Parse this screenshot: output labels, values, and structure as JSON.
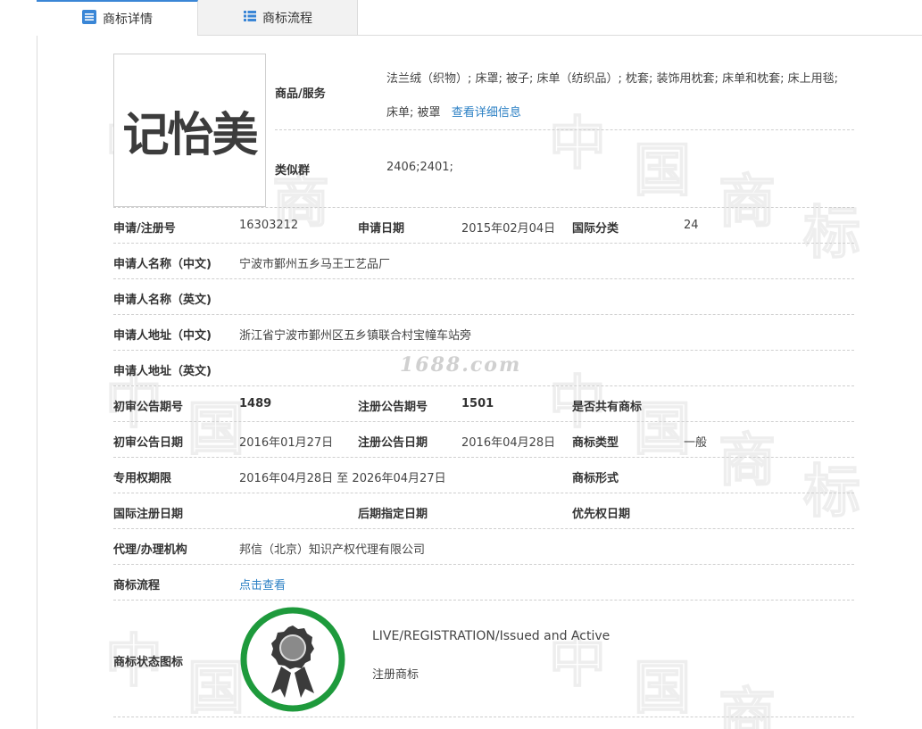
{
  "tabs": [
    {
      "label": "商标详情",
      "icon": "list-doc-icon",
      "active": true
    },
    {
      "label": "商标流程",
      "icon": "grid-list-icon",
      "active": false
    }
  ],
  "logo": {
    "text": "记怡美"
  },
  "goods": {
    "label": "商品/服务",
    "value": "法兰绒（织物）; 床罩; 被子; 床单（纺织品）; 枕套; 装饰用枕套; 床单和枕套; 床上用毯; 床单; 被罩",
    "link": "查看详细信息"
  },
  "similar": {
    "label": "类似群",
    "value": "2406;2401;"
  },
  "rows": {
    "r1": {
      "l1": "申请/注册号",
      "v1": "16303212",
      "l2": "申请日期",
      "v2": "2015年02月04日",
      "l3": "国际分类",
      "v3": "24"
    },
    "r2": {
      "l1": "申请人名称（中文)",
      "v1": "宁波市鄞州五乡马王工艺品厂"
    },
    "r3": {
      "l1": "申请人名称（英文)"
    },
    "r4": {
      "l1": "申请人地址（中文)",
      "v1": "浙江省宁波市鄞州区五乡镇联合村宝幢车站旁"
    },
    "r5": {
      "l1": "申请人地址（英文)"
    },
    "r6": {
      "l1": "初审公告期号",
      "v1": "1489",
      "l2": "注册公告期号",
      "v2": "1501",
      "l3": "是否共有商标"
    },
    "r7": {
      "l1": "初审公告日期",
      "v1": "2016年01月27日",
      "l2": "注册公告日期",
      "v2": "2016年04月28日",
      "l3": "商标类型",
      "v3": "一般"
    },
    "r8": {
      "l1": "专用权期限",
      "v1": "2016年04月28日 至 2026年04月27日",
      "l3": "商标形式"
    },
    "r9": {
      "l1": "国际注册日期",
      "l2": "后期指定日期",
      "l3": "优先权日期"
    },
    "r10": {
      "l1": "代理/办理机构",
      "v1": "邦信（北京）知识产权代理有限公司"
    },
    "r11": {
      "l1": "商标流程",
      "link": "点击查看"
    }
  },
  "status": {
    "label": "商标状态图标",
    "en": "LIVE/REGISTRATION/Issued and Active",
    "cn": "注册商标",
    "icon": "award-ribbon-icon",
    "ring_color": "#1e9a3c"
  },
  "watermark": {
    "site": "1688.com",
    "chars": [
      "中",
      "国",
      "商",
      "标"
    ]
  },
  "colors": {
    "tab_accent": "#3a86d6",
    "link": "#2a7fc4"
  }
}
